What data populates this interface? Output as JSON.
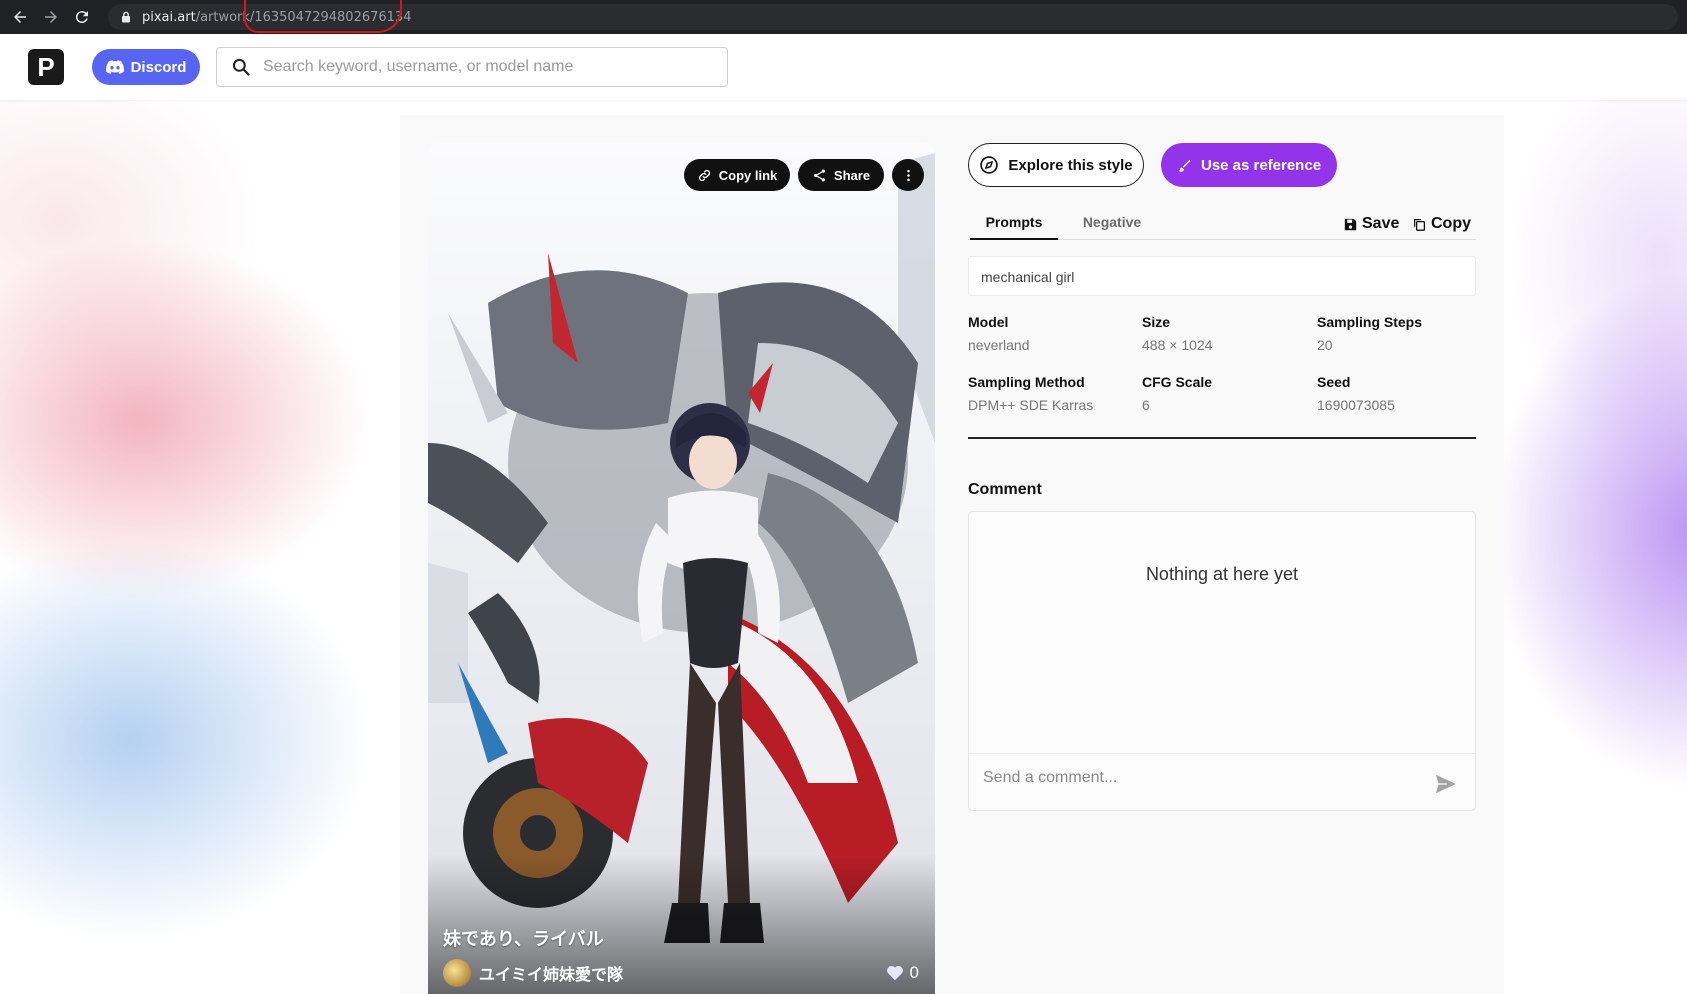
{
  "browser": {
    "url_host": "pixai.art",
    "url_path": "/artwork/1635047294802676134"
  },
  "header": {
    "logo_letter": "P",
    "discord_label": "Discord",
    "search_placeholder": "Search keyword, username, or model name"
  },
  "artwork": {
    "copy_link_label": "Copy link",
    "share_label": "Share",
    "title": "妹であり、ライバル",
    "author": "ユイミイ姉妹愛で隊",
    "likes": "0"
  },
  "actions": {
    "explore_label": "Explore this style",
    "reference_label": "Use as reference"
  },
  "tabs": {
    "prompts": "Prompts",
    "negative": "Negative",
    "save": "Save",
    "copy": "Copy"
  },
  "prompt_text": "mechanical girl",
  "meta": [
    {
      "label": "Model",
      "value": "neverland"
    },
    {
      "label": "Size",
      "value": "488 × 1024"
    },
    {
      "label": "Sampling Steps",
      "value": "20"
    },
    {
      "label": "Sampling Method",
      "value": "DPM++ SDE Karras"
    },
    {
      "label": "CFG Scale",
      "value": "6"
    },
    {
      "label": "Seed",
      "value": "1690073085"
    }
  ],
  "comments": {
    "title": "Comment",
    "empty_text": "Nothing at here yet",
    "input_placeholder": "Send a comment..."
  },
  "colors": {
    "accent_purple": "#9333ea",
    "discord_blue": "#5865f2",
    "annotation_red": "#d01919"
  },
  "icons": [
    "back-arrow-icon",
    "forward-arrow-icon",
    "reload-icon",
    "lock-icon",
    "discord-icon",
    "search-icon",
    "link-icon",
    "share-icon",
    "more-vertical-icon",
    "compass-icon",
    "brush-icon",
    "floppy-disk-icon",
    "copy-icon",
    "heart-icon",
    "send-icon"
  ]
}
